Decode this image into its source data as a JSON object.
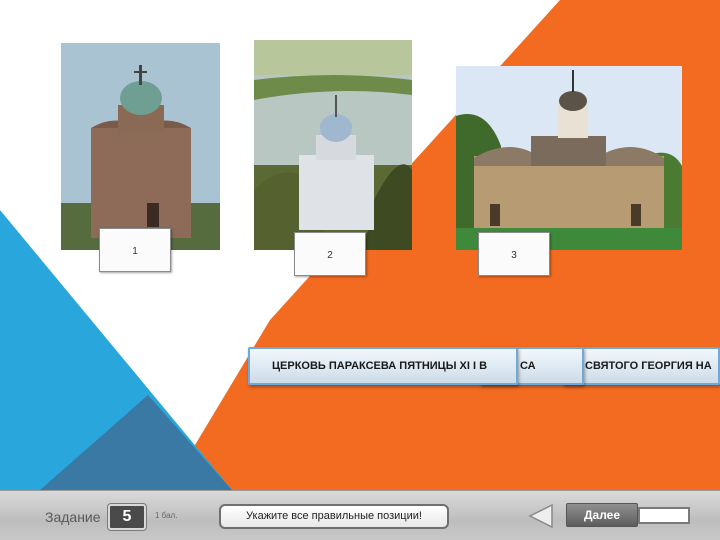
{
  "photos": [
    {
      "number": "1",
      "description": "church-with-green-dome"
    },
    {
      "number": "2",
      "description": "white-church-by-river"
    },
    {
      "number": "3",
      "description": "stone-church-with-trees"
    }
  ],
  "answers": [
    {
      "text": "ЦЕРКОВЬ ПАРАКСЕВА ПЯТНИЦЫ XI I В"
    },
    {
      "text": "СА"
    },
    {
      "text": "СВЯТОГО ГЕОРГИЯ НА"
    }
  ],
  "footer": {
    "task_label": "Задание",
    "task_number": "5",
    "score": "1 бал.",
    "hint": "Укажите все правильные позиции!",
    "next_label": "Далее"
  },
  "colors": {
    "orange": "#f36b21",
    "blue": "#29a7dd",
    "navy": "#3a79a4"
  }
}
